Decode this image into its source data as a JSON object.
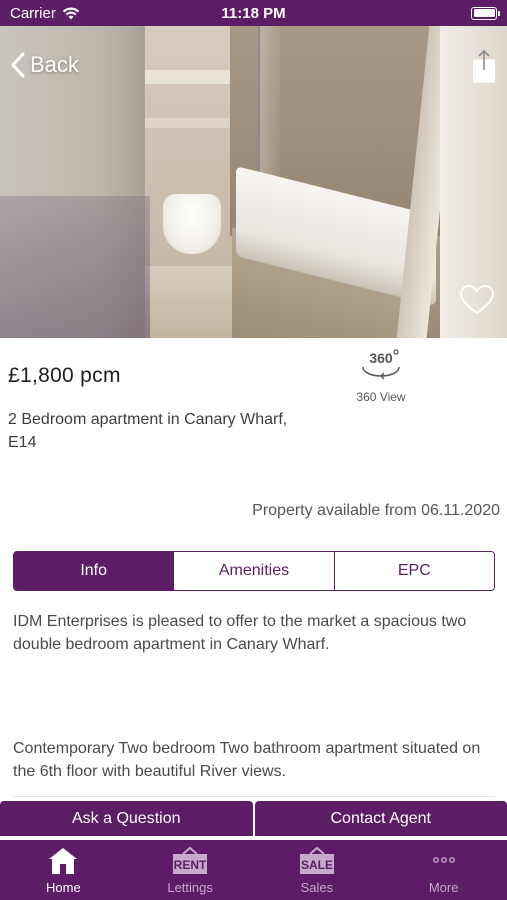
{
  "status_bar": {
    "carrier": "Carrier",
    "time": "11:18 PM"
  },
  "nav": {
    "back_label": "Back"
  },
  "listing": {
    "price": "£1,800 pcm",
    "view360_label": "360 View",
    "address": "2 Bedroom apartment in Canary Wharf, E14",
    "availability": "Property available from 06.11.2020"
  },
  "tabs": [
    {
      "label": "Info",
      "active": true
    },
    {
      "label": "Amenities",
      "active": false
    },
    {
      "label": "EPC",
      "active": false
    }
  ],
  "description": {
    "paragraph1": "IDM Enterprises is pleased to offer to the market a spacious two double bedroom apartment in Canary Wharf.",
    "paragraph2": "Contemporary Two bedroom Two bathroom apartment situated on the 6th floor with beautiful River views."
  },
  "actions": {
    "ask_label": "Ask a Question",
    "contact_label": "Contact Agent"
  },
  "tabbar": [
    {
      "label": "Home",
      "icon": "home-icon",
      "badge": "",
      "active": true
    },
    {
      "label": "Lettings",
      "icon": "rent-sign-icon",
      "badge": "RENT",
      "active": false
    },
    {
      "label": "Sales",
      "icon": "sale-sign-icon",
      "badge": "SALE",
      "active": false
    },
    {
      "label": "More",
      "icon": "more-dots-icon",
      "badge": "",
      "active": false
    }
  ],
  "colors": {
    "brand": "#5c1d66",
    "inactive_tab": "#c7a9cc"
  }
}
